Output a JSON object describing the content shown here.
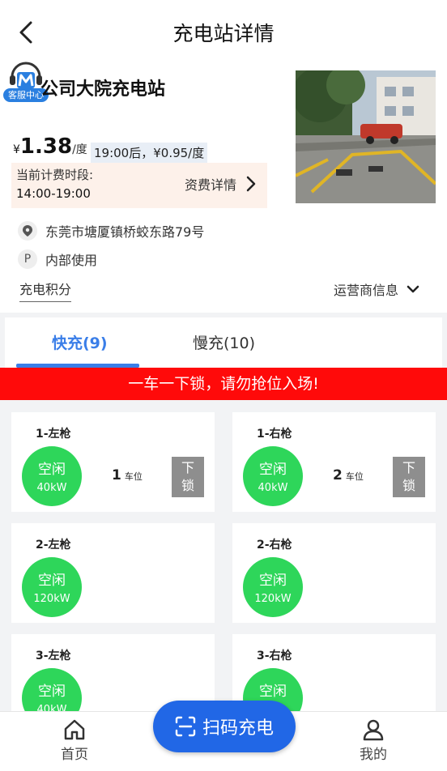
{
  "header": {
    "title": "充电站详情"
  },
  "station": {
    "service_label": "客服中心",
    "name": "公司大院充电站",
    "currency": "¥",
    "price": "1.38",
    "price_unit": "/度",
    "night_price": "19:00后，¥0.95/度",
    "period_label": "当前计费时段:",
    "period_time": "14:00-19:00",
    "fee_detail": "资费详情",
    "address": "东莞市塘厦镇桥蛟东路79号",
    "parking": "内部使用",
    "parking_badge": "P",
    "points_label": "充电积分",
    "operator_label": "运营商信息"
  },
  "tabs": {
    "fast": "快充(9)",
    "slow": "慢充(10)"
  },
  "notice": "一车一下锁，请勿抢位入场!",
  "chargers": [
    {
      "name": "1-左枪",
      "status": "空闲",
      "power": "40kW",
      "spot": "1",
      "spot_unit": "车位",
      "lock": [
        "下",
        "锁"
      ]
    },
    {
      "name": "1-右枪",
      "status": "空闲",
      "power": "40kW",
      "spot": "2",
      "spot_unit": "车位",
      "lock": [
        "下",
        "锁"
      ]
    },
    {
      "name": "2-左枪",
      "status": "空闲",
      "power": "120kW"
    },
    {
      "name": "2-右枪",
      "status": "空闲",
      "power": "120kW"
    },
    {
      "name": "3-左枪",
      "status": "空闲",
      "power": "40kW"
    },
    {
      "name": "3-右枪",
      "status": "空闲",
      "power": ""
    }
  ],
  "tabbar": {
    "home": "首页",
    "scan": "扫码充电",
    "mine": "我的"
  },
  "colors": {
    "accent": "#3a7ee8",
    "notice": "#ff0a0a",
    "idle": "#2ed65a",
    "scan_button": "#2167e6"
  }
}
